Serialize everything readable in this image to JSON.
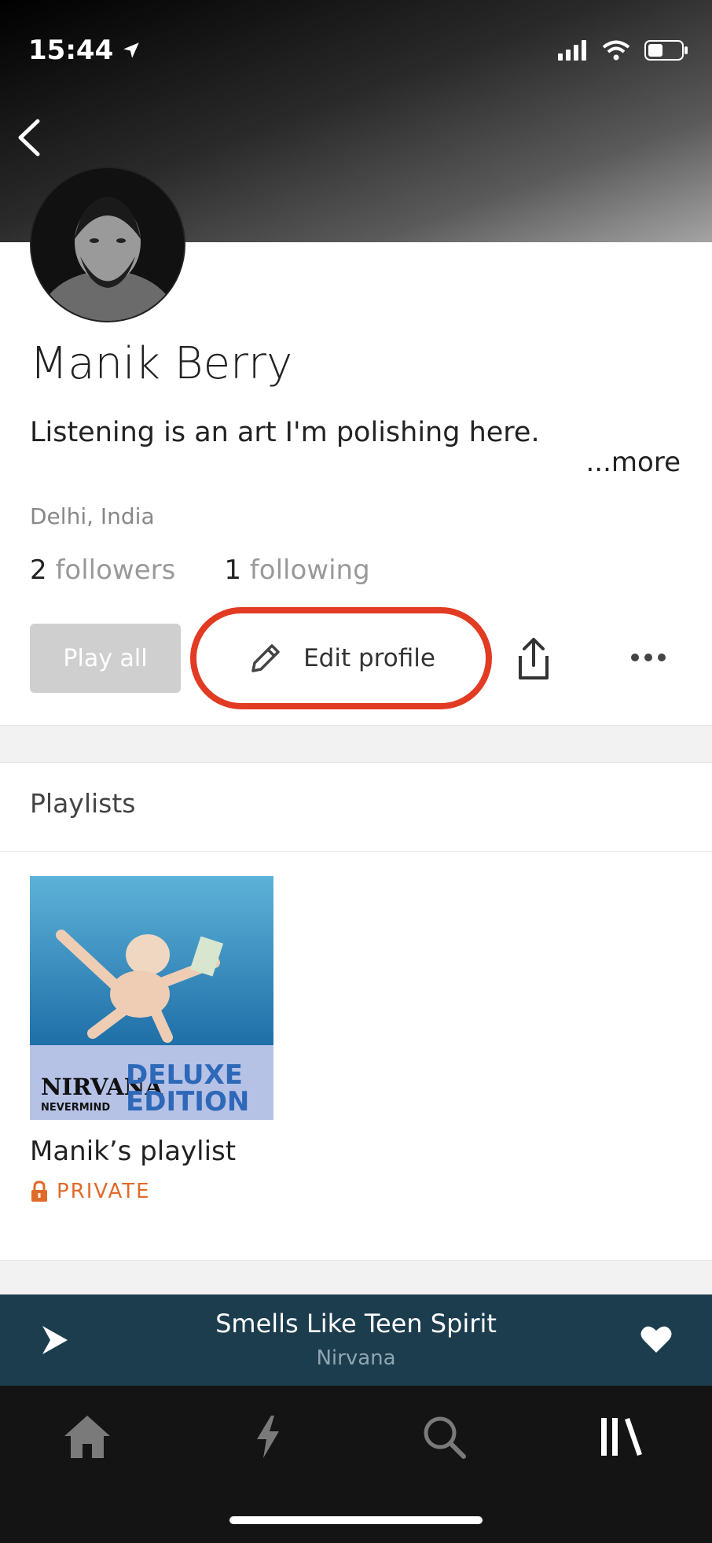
{
  "status_bar": {
    "time": "15:44"
  },
  "profile": {
    "name": "Manik Berry",
    "bio": "Listening is an art I'm polishing here.",
    "more_label": "...more",
    "location": "Delhi, India",
    "followers_count": "2",
    "followers_label": "followers",
    "following_count": "1",
    "following_label": "following"
  },
  "actions": {
    "play_all_label": "Play all",
    "edit_profile_label": "Edit profile"
  },
  "playlists": {
    "section_title": "Playlists",
    "items": [
      {
        "name": "Manik’s playlist",
        "visibility": "PRIVATE",
        "cover_text_1": "NIRVANA",
        "cover_text_2": "NEVERMIND",
        "cover_text_3": "DELUXE",
        "cover_text_4": "EDITION"
      }
    ]
  },
  "now_playing": {
    "title": "Smells Like Teen Spirit",
    "artist": "Nirvana"
  },
  "tabs": [
    {
      "icon": "home-icon"
    },
    {
      "icon": "lightning-icon"
    },
    {
      "icon": "search-icon"
    },
    {
      "icon": "library-icon"
    }
  ],
  "colors": {
    "accent_orange": "#e06a2a",
    "highlight_red": "#e23b24",
    "player_bg": "#1c3d4e"
  }
}
